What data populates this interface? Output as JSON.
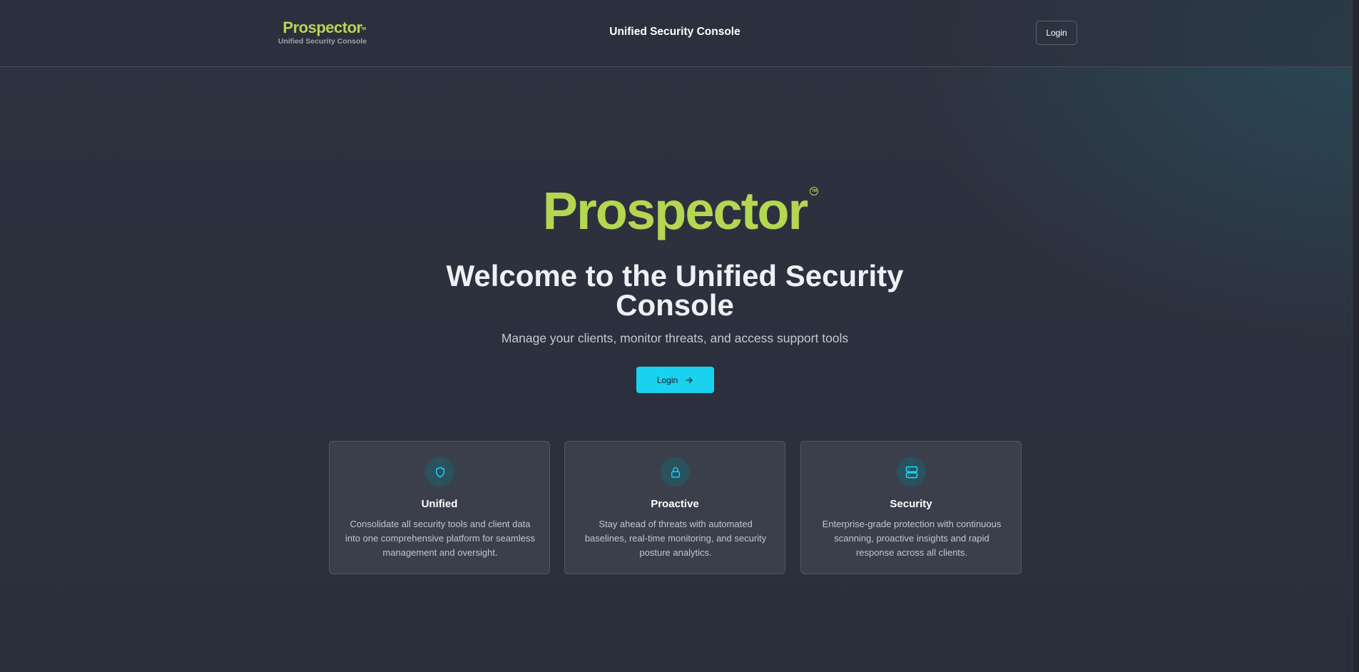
{
  "header": {
    "brand_name": "Prospector",
    "brand_tm": "TM",
    "brand_subtitle": "Unified Security Console",
    "title": "Unified Security Console",
    "login_label": "Login"
  },
  "hero": {
    "brand_name": "Prospector",
    "brand_tm": "TM",
    "title": "Welcome to the Unified Security Console",
    "subtitle": "Manage your clients, monitor threats, and access support tools",
    "login_label": "Login",
    "login_icon": "arrow-right-icon"
  },
  "features": [
    {
      "icon": "shield-icon",
      "title": "Unified",
      "description": "Consolidate all security tools and client data into one comprehensive platform for seamless management and oversight."
    },
    {
      "icon": "lock-icon",
      "title": "Proactive",
      "description": "Stay ahead of threats with automated baselines, real-time monitoring, and security posture analytics."
    },
    {
      "icon": "server-icon",
      "title": "Security",
      "description": "Enterprise-grade protection with continuous scanning, proactive insights and rapid response across all clients."
    }
  ],
  "colors": {
    "brand_green": "#b5d651",
    "accent_cyan": "#19d2f0",
    "background": "#2c303d",
    "icon_circle": "#29515e"
  }
}
